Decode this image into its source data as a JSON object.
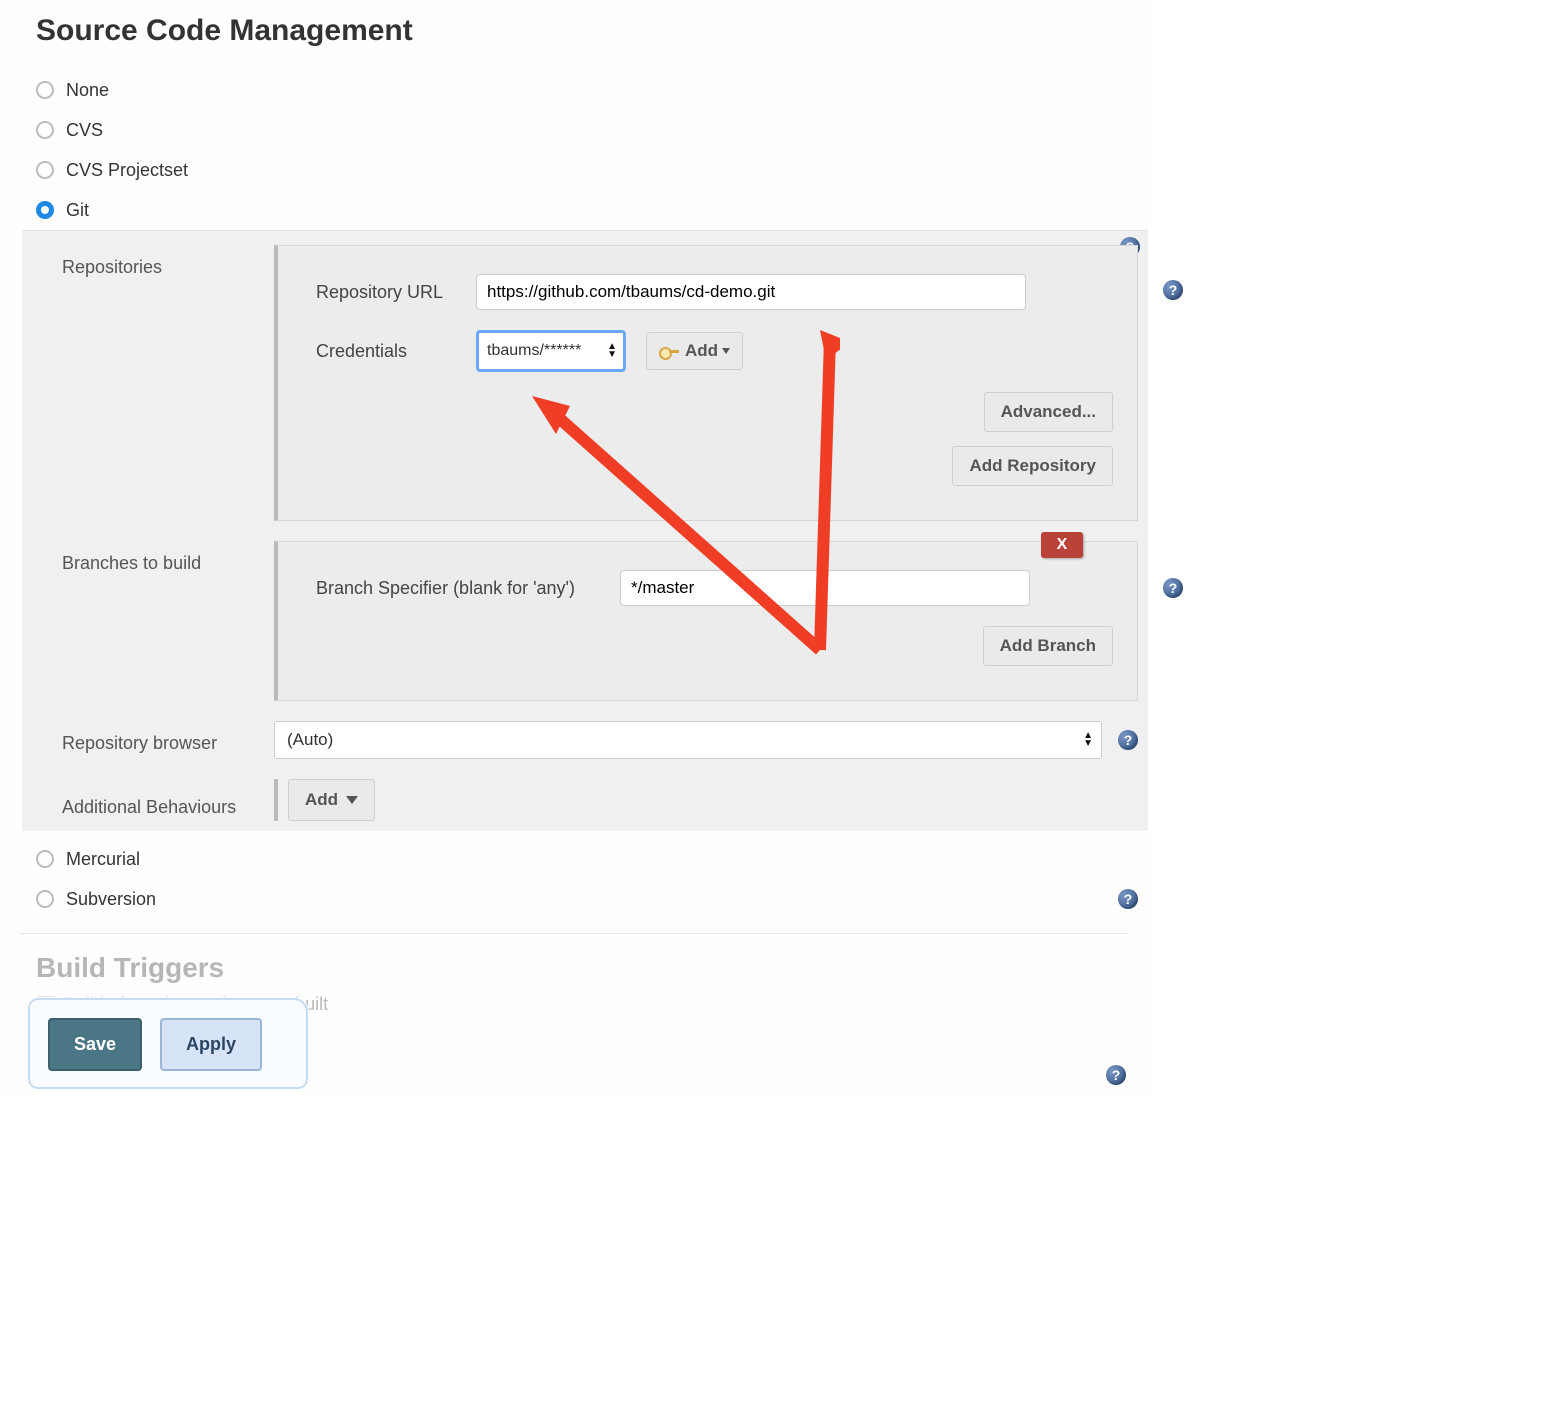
{
  "section_title": "Source Code Management",
  "scm_options": {
    "none": "None",
    "cvs": "CVS",
    "cvs_projectset": "CVS Projectset",
    "git": "Git",
    "mercurial": "Mercurial",
    "subversion": "Subversion"
  },
  "git": {
    "repositories_label": "Repositories",
    "repo_url_label": "Repository URL",
    "repo_url_value": "https://github.com/tbaums/cd-demo.git",
    "credentials_label": "Credentials",
    "credentials_value": "tbaums/******",
    "add_cred_label": "Add",
    "advanced_label": "Advanced...",
    "add_repo_label": "Add Repository",
    "branches_label": "Branches to build",
    "branch_specifier_label": "Branch Specifier (blank for 'any')",
    "branch_specifier_value": "*/master",
    "add_branch_label": "Add Branch",
    "repo_browser_label": "Repository browser",
    "repo_browser_value": "(Auto)",
    "additional_behaviours_label": "Additional Behaviours",
    "add_behaviour_label": "Add",
    "delete_x": "X"
  },
  "build_triggers": {
    "title": "Build Triggers",
    "after_other": "Build after other projects are built"
  },
  "buttons": {
    "save": "Save",
    "apply": "Apply"
  }
}
